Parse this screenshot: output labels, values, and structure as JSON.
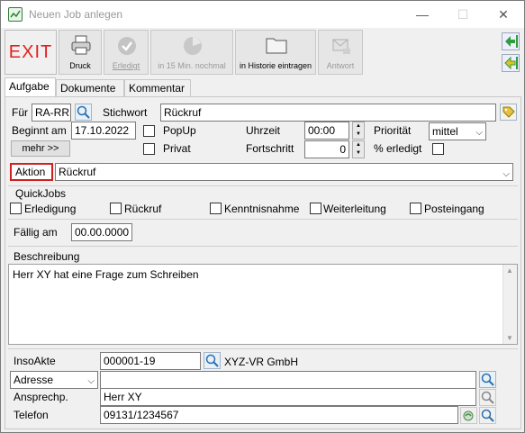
{
  "window": {
    "title": "Neuen Job anlegen"
  },
  "toolbar": {
    "exit": "EXIT",
    "druck": "Druck",
    "erledigt": "Erledigt",
    "in15": "in 15 Min. nochmal",
    "historie": "in Historie eintragen",
    "antwort": "Antwort"
  },
  "tabs": [
    "Aufgabe",
    "Dokumente",
    "Kommentar"
  ],
  "form": {
    "fuer_label": "Für",
    "fuer_value": "RA-RR",
    "stichwort_label": "Stichwort",
    "stichwort_value": "Rückruf",
    "beginnt_label": "Beginnt am",
    "beginnt_value": "17.10.2022",
    "popup_label": "PopUp",
    "uhrzeit_label": "Uhrzeit",
    "uhrzeit_value": "00:00",
    "prioritaet_label": "Priorität",
    "prioritaet_value": "mittel",
    "mehr_label": "mehr >>",
    "privat_label": "Privat",
    "fortschritt_label": "Fortschritt",
    "fortschritt_value": "0",
    "erledigt_label": "% erledigt",
    "aktion_label": "Aktion",
    "aktion_value": "Rückruf"
  },
  "quickjobs": {
    "title": "QuickJobs",
    "items": [
      "Erledigung",
      "Rückruf",
      "Kenntnisnahme",
      "Weiterleitung",
      "Posteingang"
    ]
  },
  "faellig": {
    "label": "Fällig am",
    "value": "00.00.0000"
  },
  "beschreibung": {
    "label": "Beschreibung",
    "text": "Herr XY hat eine Frage zum Schreiben"
  },
  "akte": {
    "insoakte_label": "InsoAkte",
    "insoakte_value": "000001-19",
    "insoakte_name": "XYZ-VR GmbH",
    "adresse_label": "Adresse",
    "adresse_value": "",
    "ansprech_label": "Ansprechp.",
    "ansprech_value": "Herr  XY",
    "telefon_label": "Telefon",
    "telefon_value": "09131/1234567"
  },
  "colors": {
    "exit_red": "#e02020",
    "aktion_border": "#d02020",
    "nav_green": "#2e9d3a"
  }
}
